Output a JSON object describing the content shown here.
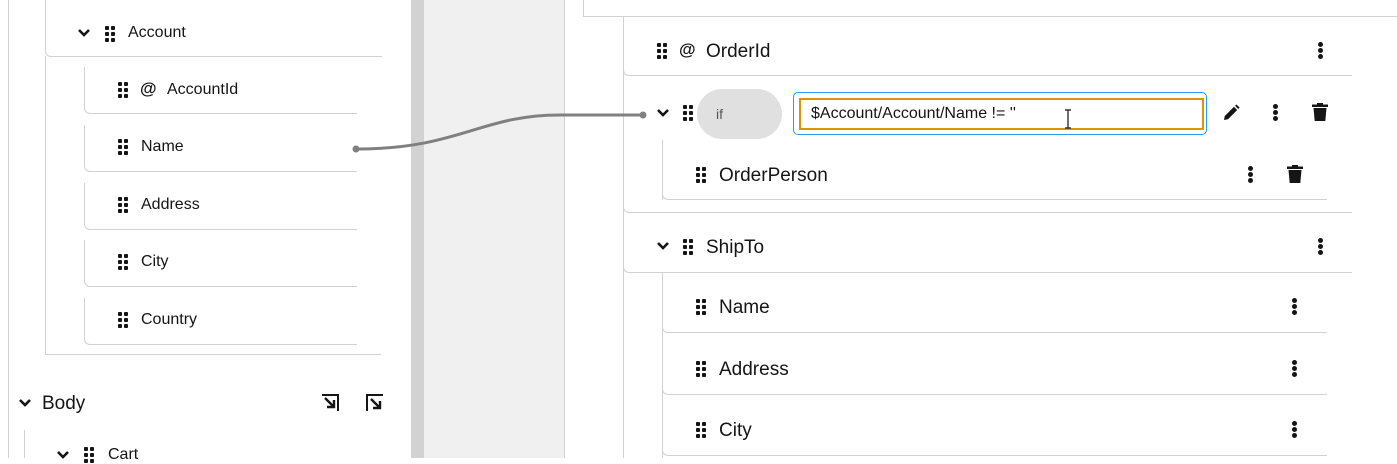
{
  "source": {
    "account_label": "Account",
    "fields": [
      {
        "label": "AccountId",
        "attribute": true
      },
      {
        "label": "Name",
        "attribute": false
      },
      {
        "label": "Address",
        "attribute": false
      },
      {
        "label": "City",
        "attribute": false
      },
      {
        "label": "Country",
        "attribute": false
      }
    ],
    "body_label": "Body",
    "cart_label": "Cart"
  },
  "target": {
    "order_id_label": "OrderId",
    "if_label": "if",
    "condition_value": "$Account/Account/Name != ''",
    "order_person_label": "OrderPerson",
    "ship_to_label": "ShipTo",
    "ship_to_children": [
      "Name",
      "Address",
      "City"
    ]
  },
  "colors": {
    "condition_border": "#e09300",
    "condition_focus_ring": "#2b9af3",
    "if_pill": "#e0e0e0",
    "connector": "#808080"
  },
  "icons": [
    "drag-handle-icon",
    "chevron-down-icon",
    "at-sign-icon",
    "kebab-icon",
    "pencil-icon",
    "trash-icon",
    "expand-arrow-icon",
    "collapse-arrow-icon"
  ]
}
